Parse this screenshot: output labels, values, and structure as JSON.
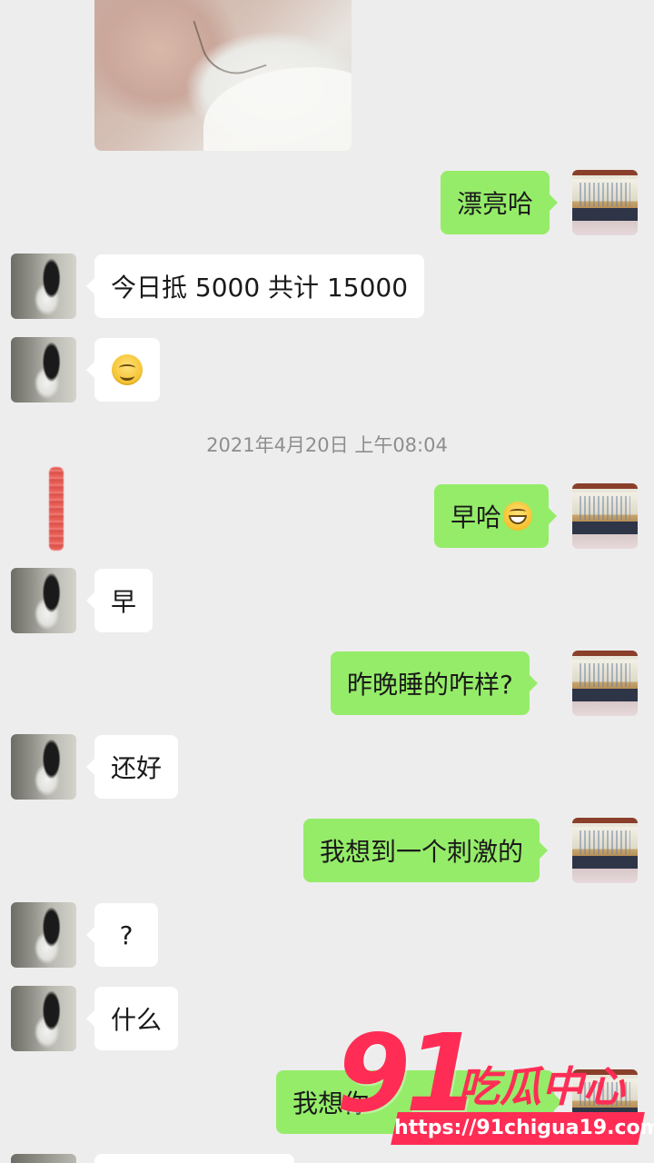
{
  "conversation": {
    "timestamp": "2021年4月20日 上午08:04",
    "messages": [
      {
        "side": "in",
        "type": "image"
      },
      {
        "side": "out",
        "text": "漂亮哈"
      },
      {
        "side": "in",
        "text": "今日抵 5000 共计 15000"
      },
      {
        "side": "in",
        "type": "emoji",
        "emoji": "smiling-face-icon"
      },
      {
        "side": "out",
        "text": "早哈",
        "emoji": "grinning-face-icon"
      },
      {
        "side": "in",
        "text": "早"
      },
      {
        "side": "out",
        "text": "昨晚睡的咋样?"
      },
      {
        "side": "in",
        "text": "还好"
      },
      {
        "side": "out",
        "text": "我想到一个刺激的"
      },
      {
        "side": "in",
        "text": "?"
      },
      {
        "side": "in",
        "text": "什么"
      },
      {
        "side": "out",
        "text": "我想你"
      }
    ]
  },
  "watermark": {
    "number": "91",
    "name": "吃瓜中心",
    "url": "https://91chigua19.com"
  },
  "colors": {
    "background": "#ededed",
    "outgoing_bubble": "#95ec69",
    "incoming_bubble": "#ffffff",
    "watermark": "#ff2d55"
  }
}
